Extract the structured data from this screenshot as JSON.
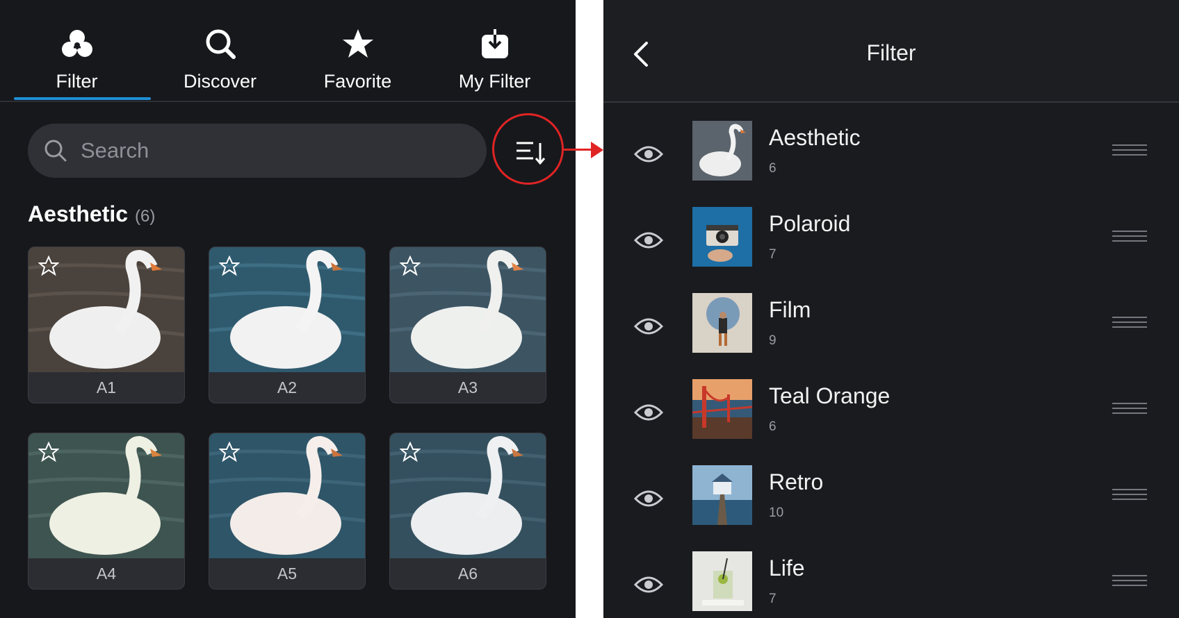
{
  "left_panel": {
    "tabs": [
      {
        "label": "Filter",
        "icon": "filter-circles-icon",
        "active": true
      },
      {
        "label": "Discover",
        "icon": "search-icon",
        "active": false
      },
      {
        "label": "Favorite",
        "icon": "star-icon",
        "active": false
      },
      {
        "label": "My Filter",
        "icon": "download-box-icon",
        "active": false
      }
    ],
    "search": {
      "placeholder": "Search"
    },
    "sort_button_icon": "sort-list-icon",
    "section": {
      "title": "Aesthetic",
      "count": "(6)"
    },
    "cards": [
      {
        "label": "A1"
      },
      {
        "label": "A2"
      },
      {
        "label": "A3"
      },
      {
        "label": "A4"
      },
      {
        "label": "A5"
      },
      {
        "label": "A6"
      }
    ]
  },
  "right_panel": {
    "title": "Filter",
    "rows": [
      {
        "name": "Aesthetic",
        "count": "6"
      },
      {
        "name": "Polaroid",
        "count": "7"
      },
      {
        "name": "Film",
        "count": "9"
      },
      {
        "name": "Teal Orange",
        "count": "6"
      },
      {
        "name": "Retro",
        "count": "10"
      },
      {
        "name": "Life",
        "count": "7"
      }
    ]
  },
  "colors": {
    "background_dark": "#17181c",
    "accent_blue": "#1f8fd6",
    "highlight_red": "#e02424"
  }
}
